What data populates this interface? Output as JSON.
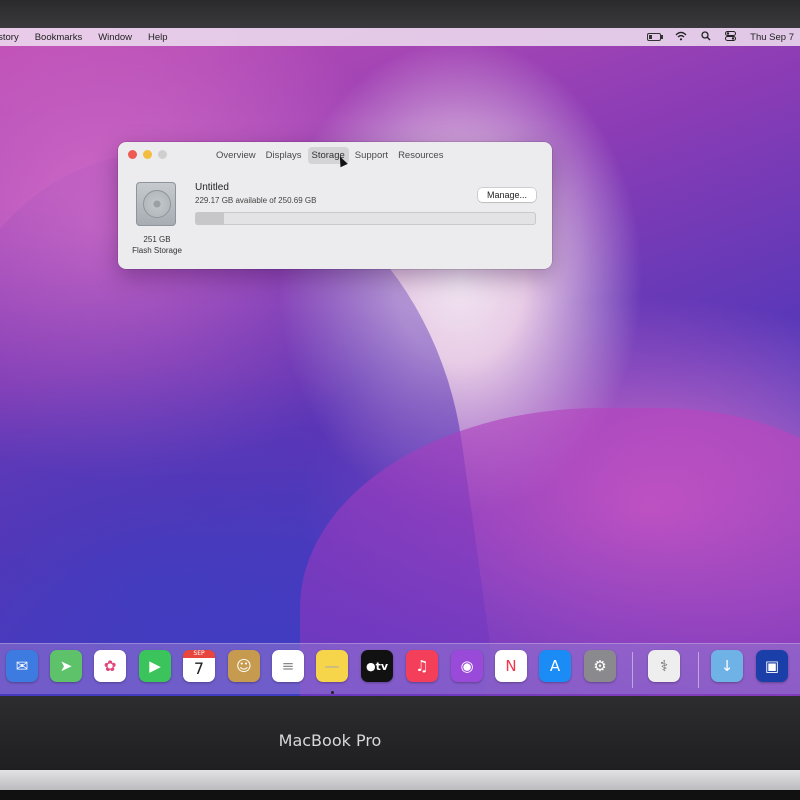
{
  "menubar": {
    "items": [
      "istory",
      "Bookmarks",
      "Window",
      "Help"
    ],
    "clock": "Thu Sep 7",
    "icons": [
      "battery-icon",
      "wifi-icon",
      "spotlight-icon",
      "control-center-icon"
    ]
  },
  "window": {
    "tabs": [
      "Overview",
      "Displays",
      "Storage",
      "Support",
      "Resources"
    ],
    "active_tab": "Storage",
    "drive_capacity": "251 GB",
    "drive_type": "Flash Storage",
    "volume_name": "Untitled",
    "volume_summary": "229.17 GB available of 250.69 GB",
    "manage_label": "Manage...",
    "used_fraction": 0.086
  },
  "dock": {
    "apps": [
      {
        "name": "Mail",
        "icon": "mail-icon",
        "color": "#3d7be0"
      },
      {
        "name": "Maps",
        "icon": "maps-icon",
        "color": "#5ec26a"
      },
      {
        "name": "Photos",
        "icon": "photos-icon",
        "color": "#ffffff"
      },
      {
        "name": "FaceTime",
        "icon": "facetime-icon",
        "color": "#3ac45b"
      },
      {
        "name": "Calendar",
        "icon": "calendar-icon",
        "color": "#ffffff",
        "month": "SEP",
        "day": "7"
      },
      {
        "name": "Contacts",
        "icon": "contacts-icon",
        "color": "#c79b4f"
      },
      {
        "name": "Reminders",
        "icon": "reminders-icon",
        "color": "#ffffff"
      },
      {
        "name": "Notes",
        "icon": "notes-icon",
        "color": "#f7d54a"
      },
      {
        "name": "TV",
        "icon": "tv-icon",
        "color": "#111111",
        "label": "tv"
      },
      {
        "name": "Music",
        "icon": "music-icon",
        "color": "#f43f5b"
      },
      {
        "name": "Podcasts",
        "icon": "podcasts-icon",
        "color": "#9a4ad9"
      },
      {
        "name": "News",
        "icon": "news-icon",
        "color": "#ffffff"
      },
      {
        "name": "App Store",
        "icon": "app-store-icon",
        "color": "#1b8cf5"
      },
      {
        "name": "System Preferences",
        "icon": "system-preferences-icon",
        "color": "#8a8a8e"
      },
      {
        "name": "Disk Utility",
        "icon": "disk-utility-icon",
        "color": "#eeeeee"
      },
      {
        "name": "Downloads",
        "icon": "downloads-folder-icon",
        "color": "#6fb3e6"
      },
      {
        "name": "Screen",
        "icon": "screenshot-icon",
        "color": "#1b3fa8"
      }
    ]
  },
  "hardware": {
    "brand": "MacBook Pro"
  }
}
